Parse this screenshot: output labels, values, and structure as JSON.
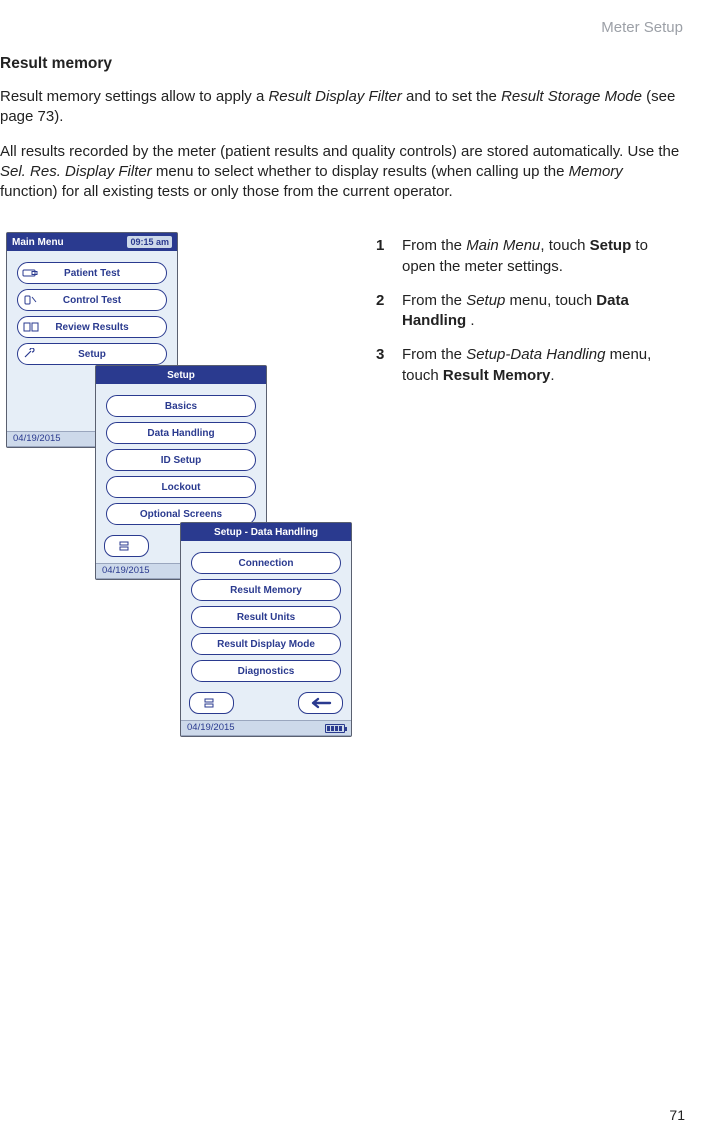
{
  "page_header": "Meter Setup",
  "page_number": "71",
  "section_title": "Result memory",
  "intro_text_1_pre": "Result memory settings allow to apply a ",
  "intro_text_1_ital_1": "Result Display Filter",
  "intro_text_1_mid": " and to set the ",
  "intro_text_1_ital_2": "Result Storage Mode",
  "intro_text_1_post": " (see page 73).",
  "intro_text_2_pre": "All results recorded by the meter (patient results and quality controls) are stored automatically. Use the ",
  "intro_text_2_ital_1": "Sel. Res. Display Filter",
  "intro_text_2_mid": " menu to select whether to display results (when calling up the ",
  "intro_text_2_ital_2": "Memory",
  "intro_text_2_post": " function) for all existing tests or only those from the current operator.",
  "steps": [
    {
      "num": "1",
      "pre": "From the ",
      "ital": "Main Menu",
      "mid": ", touch ",
      "bold": "Setup",
      "post": " to open the meter settings."
    },
    {
      "num": "2",
      "pre": "From the ",
      "ital": "Setup",
      "mid": " menu, touch ",
      "bold": "Data Handling",
      "post": " ."
    },
    {
      "num": "3",
      "pre": "From the ",
      "ital": "Setup-Data Handling",
      "mid": " menu, touch ",
      "bold": "Result Memory",
      "post": "."
    }
  ],
  "devices": {
    "main": {
      "title": "Main Menu",
      "time": "09:15 am",
      "items": [
        "Patient Test",
        "Control Test",
        "Review Results",
        "Setup"
      ],
      "date": "04/19/2015"
    },
    "setup": {
      "title": "Setup",
      "items": [
        "Basics",
        "Data Handling",
        "ID Setup",
        "Lockout",
        "Optional Screens"
      ],
      "date": "04/19/2015"
    },
    "data": {
      "title": "Setup - Data Handling",
      "items": [
        "Connection",
        "Result Memory",
        "Result Units",
        "Result Display Mode",
        "Diagnostics"
      ],
      "date": "04/19/2015"
    }
  }
}
